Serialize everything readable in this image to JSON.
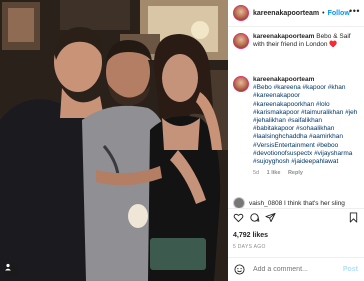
{
  "post": {
    "username": "kareenakapoorteam",
    "follow_label": "Follow",
    "more_label": "•••",
    "separator": "•",
    "caption_user": "kareenakapoorteam",
    "caption_text": "Bebo & Saif with their friend in London ♥️",
    "comment_user": "kareenakapoorteam",
    "comment_text": "#Bebo #kareena #kapoor #khan #kareenakapoor #kareenakapoorkhan #lolo #karismakapoor #taimuralikhan #jeh #jehalikhan #saifalikhan #babitakapoor #sohaalikhan #laalsinghchaddha #aamirkhan #VersisEntertainment #beboo #devotionofsuspectx #vijaysharma #sujoyghosh #jaideepahlawat",
    "comment_meta": {
      "time": "5d",
      "likes": "1 like",
      "reply": "Reply"
    },
    "reply_peek": "vaish_0808 I think that's her sling",
    "likes_count": "4,792 likes",
    "date": "5 DAYS AGO",
    "add_comment_placeholder": "Add a comment...",
    "post_label": "Post"
  },
  "icons": {
    "heart": "heart-icon",
    "comment": "comment-icon",
    "share": "share-icon",
    "save": "bookmark-icon",
    "emoji": "emoji-icon",
    "user": "user-tag-icon"
  },
  "colors": {
    "accent": "#0095f6",
    "heart_red": "#ed4956",
    "muted": "#8e8e8e",
    "hashtag": "#00376b"
  }
}
